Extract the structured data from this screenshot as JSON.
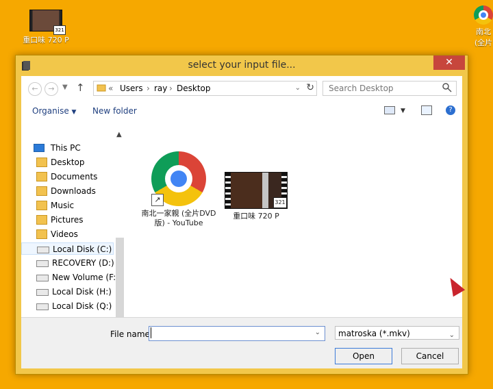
{
  "desktop": {
    "top_left_icon_label": "重口味 720 P",
    "top_right_icon_label": "南北\n(全片"
  },
  "dialog": {
    "title": "select your input file...",
    "close": "✕",
    "nav": {
      "back": "←",
      "forward": "→",
      "up": "↑",
      "breadcrumb": [
        "«",
        "Users",
        "ray",
        "Desktop"
      ],
      "refresh": "↻",
      "search_placeholder": "Search Desktop"
    },
    "toolbar": {
      "organise": "Organise",
      "new_folder": "New folder"
    },
    "sidebar": {
      "this_pc": "This PC",
      "items": [
        {
          "label": "Desktop",
          "icon": "folder-icon"
        },
        {
          "label": "Documents",
          "icon": "folder-icon"
        },
        {
          "label": "Downloads",
          "icon": "folder-icon"
        },
        {
          "label": "Music",
          "icon": "folder-icon"
        },
        {
          "label": "Pictures",
          "icon": "folder-icon"
        },
        {
          "label": "Videos",
          "icon": "folder-icon"
        },
        {
          "label": "Local Disk (C:)",
          "icon": "drive-icon",
          "selected": true
        },
        {
          "label": "RECOVERY (D:)",
          "icon": "drive-icon"
        },
        {
          "label": "New Volume (F:)",
          "icon": "drive-icon"
        },
        {
          "label": "Local Disk (H:)",
          "icon": "drive-icon"
        },
        {
          "label": "Local Disk (Q:)",
          "icon": "drive-icon"
        }
      ]
    },
    "files": [
      {
        "name": "南北一家親 (全片DVD版) - YouTube",
        "type": "shortcut"
      },
      {
        "name": "重口味 720 P",
        "type": "video"
      }
    ],
    "bottom": {
      "file_name_label": "File name:",
      "file_name_value": "",
      "file_type_value": "matroska (*.mkv)",
      "open": "Open",
      "cancel": "Cancel"
    }
  }
}
